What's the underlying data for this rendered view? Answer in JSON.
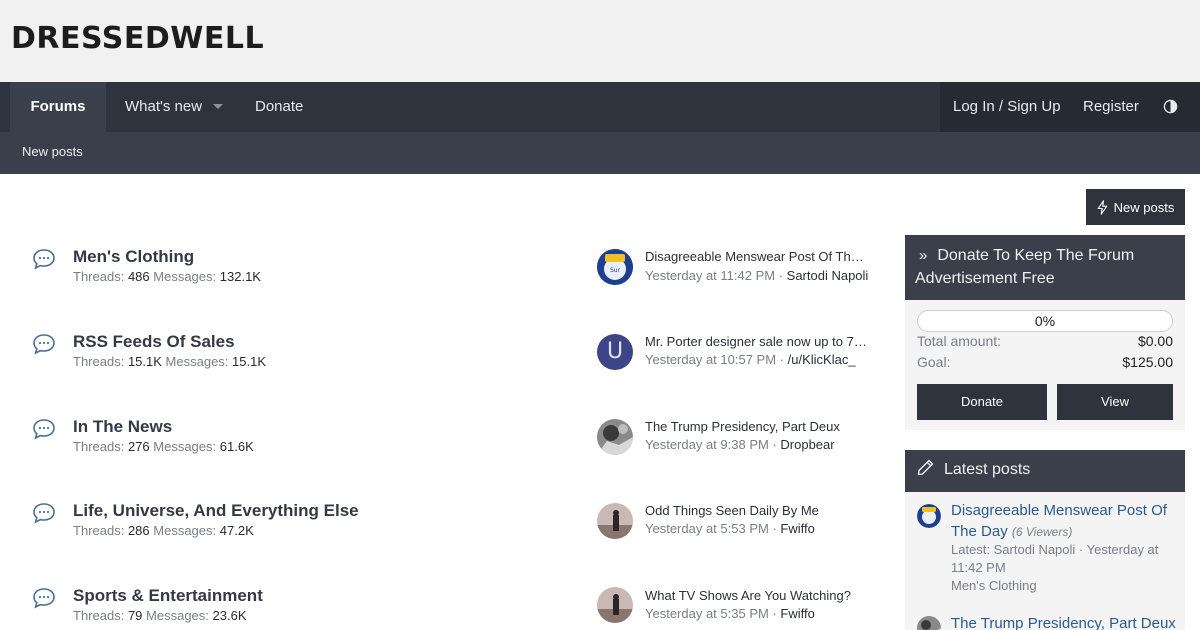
{
  "site": {
    "logo": "DRESSEDWELL"
  },
  "nav": {
    "forums": "Forums",
    "whats_new": "What's new",
    "donate": "Donate",
    "login": "Log In / Sign Up",
    "register": "Register",
    "theme_icon": "theme-toggle-icon"
  },
  "subnav": {
    "new_posts": "New posts"
  },
  "actions": {
    "new_posts_button": "New posts",
    "new_posts_icon": "lightning-icon"
  },
  "forums": [
    {
      "title": "Men's Clothing",
      "threads_label": "Threads:",
      "threads": "486",
      "messages_label": "Messages:",
      "messages": "132.1K",
      "last_post_title": "Disagreeable Menswear Post Of The ...",
      "last_post_time": "Yesterday at 11:42 PM",
      "last_post_user": "Sartodi Napoli"
    },
    {
      "title": "RSS Feeds Of Sales",
      "threads_label": "Threads:",
      "threads": "15.1K",
      "messages_label": "Messages:",
      "messages": "15.1K",
      "last_post_title": "Mr. Porter designer sale now up to 70...",
      "last_post_time": "Yesterday at 10:57 PM",
      "last_post_user": "/u/KlicKlac_",
      "avatar_letter": "U"
    },
    {
      "title": "In The News",
      "threads_label": "Threads:",
      "threads": "276",
      "messages_label": "Messages:",
      "messages": "61.6K",
      "last_post_title": "The Trump Presidency, Part Deux",
      "last_post_time": "Yesterday at 9:38 PM",
      "last_post_user": "Dropbear"
    },
    {
      "title": "Life, Universe, And Everything Else",
      "threads_label": "Threads:",
      "threads": "286",
      "messages_label": "Messages:",
      "messages": "47.2K",
      "last_post_title": "Odd Things Seen Daily By Me",
      "last_post_time": "Yesterday at 5:53 PM",
      "last_post_user": "Fwiffo"
    },
    {
      "title": "Sports & Entertainment",
      "threads_label": "Threads:",
      "threads": "79",
      "messages_label": "Messages:",
      "messages": "23.6K",
      "last_post_title": "What TV Shows Are You Watching?",
      "last_post_time": "Yesterday at 5:35 PM",
      "last_post_user": "Fwiffo"
    }
  ],
  "donation": {
    "title": "Donate To Keep The Forum Advertisement Free",
    "progress_text": "0%",
    "progress_value": 0,
    "total_label": "Total amount:",
    "total_value": "$0.00",
    "goal_label": "Goal:",
    "goal_value": "$125.00",
    "donate_button": "Donate",
    "view_button": "View"
  },
  "latest_posts": {
    "title": "Latest posts",
    "items": [
      {
        "title": "Disagreeable Menswear Post Of The Day",
        "viewers": "(6 Viewers)",
        "meta_latest": "Latest: Sartodi Napoli · Yesterday at 11:42 PM",
        "forum": "Men's Clothing"
      },
      {
        "title": "The Trump Presidency, Part Deux"
      }
    ]
  },
  "colors": {
    "nav_bg": "#2e333d",
    "subnav_bg": "#3a3f4b",
    "link_blue": "#2b5a8c",
    "header_bg": "#f1f1f1"
  }
}
